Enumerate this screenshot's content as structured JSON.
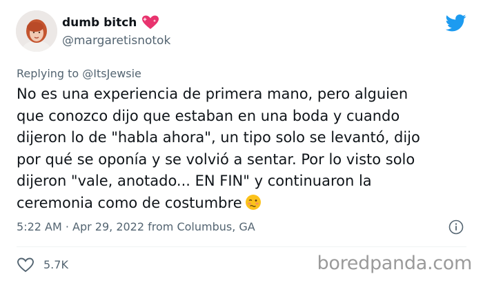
{
  "author": {
    "display_name": "dumb bitch",
    "handle": "@margaretisnotok",
    "name_emoji": "sparkling-heart-icon"
  },
  "reply": {
    "prefix": "Replying to ",
    "mention": "@ItsJewsie"
  },
  "tweet": {
    "text": "No es una experiencia de primera mano, pero alguien\nque conozco dijo que estaban en una boda y cuando\ndijeron lo de \"habla ahora\", un tipo solo se levantó, dijo\npor qué se oponía y se volvió a sentar. Por lo visto solo\ndijeron \"vale, anotado... EN FIN\" y continuaron la\nceremonia como de costumbre",
    "trailing_emoji": "woozy-face-icon"
  },
  "meta": {
    "timestamp": "5:22 AM · Apr 29, 2022 from Columbus, GA"
  },
  "actions": {
    "like_count": "5.7K"
  },
  "watermark": "boredpanda.com",
  "colors": {
    "text": "#0f1419",
    "muted": "#536471",
    "twitter_blue": "#1d9bf0",
    "heart_pink": "#e8336e",
    "watermark": "#9a9a9a"
  }
}
